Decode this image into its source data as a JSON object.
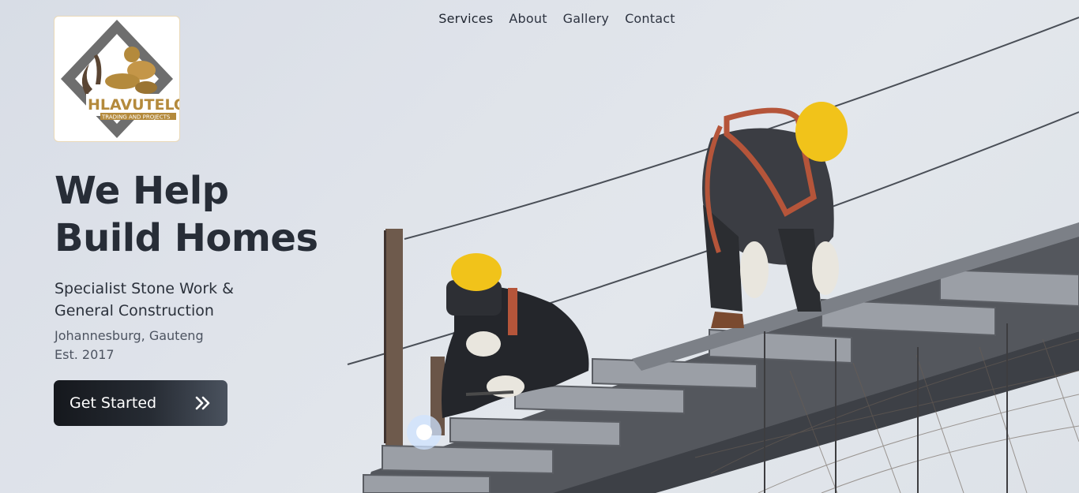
{
  "nav": {
    "items": [
      "Services",
      "About",
      "Gallery",
      "Contact"
    ]
  },
  "logo": {
    "brand": "HLAVUTELO",
    "tagline": "TRADING AND PROJECTS",
    "icon": "brand-logo"
  },
  "hero": {
    "headline_line1": "We Help",
    "headline_line2": "Build Homes",
    "subtitle_line1": "Specialist Stone Work &",
    "subtitle_line2": "General Construction",
    "location": "Johannesburg, Gauteng",
    "established": "Est. 2017",
    "cta_label": "Get Started",
    "cta_icon": "double-chevron-right-icon",
    "photo": "construction-workers-welding-steel-frame-image"
  },
  "colors": {
    "text_dark": "#272d37",
    "button_dark": "#15181d",
    "logo_gold": "#b48a3c",
    "logo_grey": "#6b6b6b",
    "helmet_yellow": "#f2c400"
  }
}
